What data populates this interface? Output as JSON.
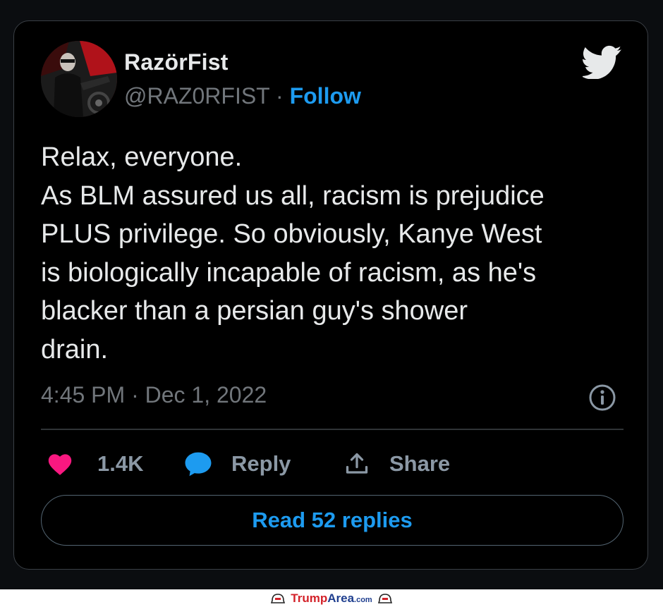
{
  "tweet": {
    "display_name": "RazörFist",
    "handle": "@RAZ0RFIST",
    "separator": "·",
    "follow_label": "Follow",
    "text_lines": [
      "Relax, everyone.",
      "As BLM assured us all, racism is prejudice",
      "PLUS privilege. So obviously, Kanye West",
      "is biologically incapable of racism, as he's",
      "blacker than a persian guy's shower",
      "drain."
    ],
    "timestamp": "4:45 PM · Dec 1, 2022",
    "likes": "1.4K",
    "reply_label": "Reply",
    "share_label": "Share",
    "read_replies_label": "Read 52 replies"
  },
  "icons": {
    "brand": "twitter-bird-icon",
    "info": "info-icon",
    "like": "heart-icon",
    "reply": "speech-bubble-icon",
    "share": "share-upload-icon"
  },
  "colors": {
    "accent": "#1d9bf0",
    "like": "#f91880",
    "background": "#000000",
    "text": "#e7e9ea",
    "muted": "#71767b"
  },
  "watermark": {
    "brand_trump": "Trump",
    "brand_area": "Area",
    "brand_com": ".com"
  }
}
